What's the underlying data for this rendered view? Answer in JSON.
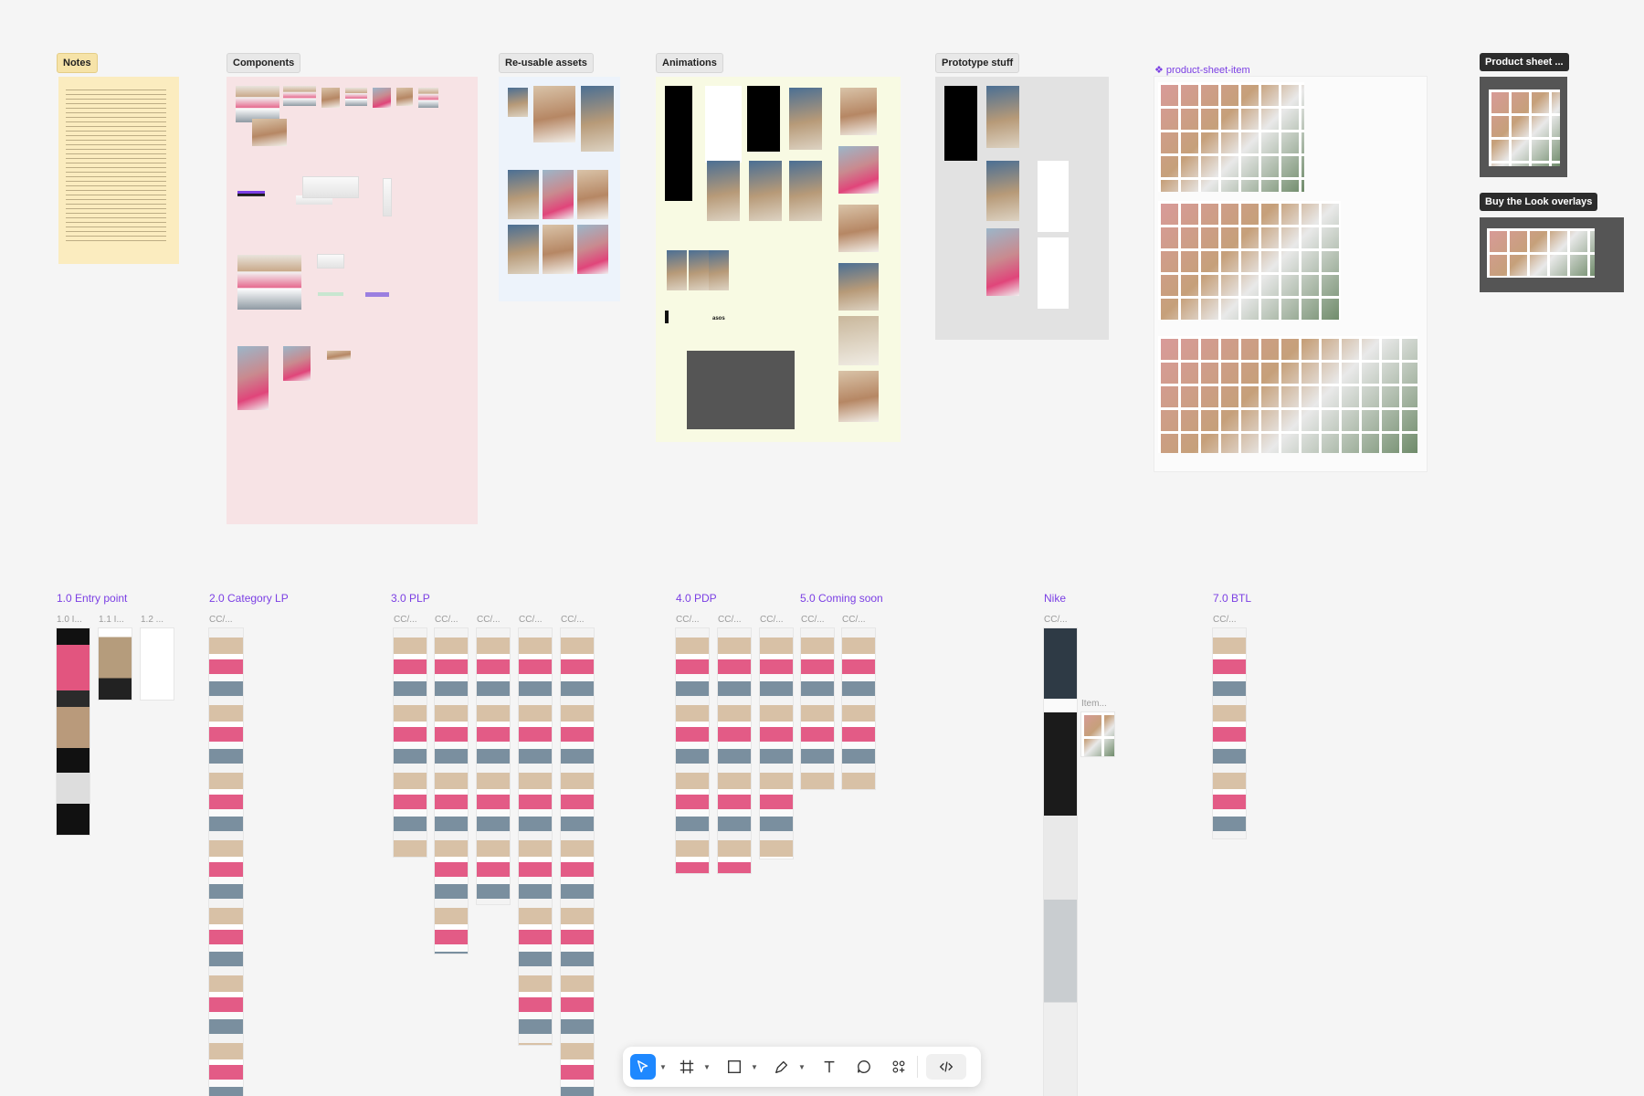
{
  "top_tags": {
    "notes": "Notes",
    "components": "Components",
    "reusable": "Re-usable assets",
    "animations": "Animations",
    "prototype": "Prototype stuff",
    "product_sheet_item": "product-sheet-item",
    "product_sheet": "Product sheet ...",
    "buy_the_look": "Buy the Look overlays"
  },
  "sections": [
    {
      "title": "1.0 Entry point",
      "labels": [
        "1.0 I...",
        "1.1 I...",
        "1.2 ..."
      ]
    },
    {
      "title": "2.0 Category LP",
      "labels": [
        "CC/..."
      ]
    },
    {
      "title": "3.0 PLP",
      "labels": [
        "CC/...",
        "CC/...",
        "CC/...",
        "CC/...",
        "CC/..."
      ]
    },
    {
      "title": "4.0 PDP",
      "labels": [
        "CC/...",
        "CC/...",
        "CC/..."
      ]
    },
    {
      "title": "5.0 Coming soon",
      "labels": [
        "CC/...",
        "CC/..."
      ]
    },
    {
      "title": "Nike",
      "labels": [
        "CC/..."
      ]
    },
    {
      "title": "7.0 BTL",
      "labels": [
        "CC/..."
      ]
    }
  ],
  "nike_item_label": "Item...",
  "brand_text": "asos",
  "toolbar": {
    "tools": [
      "move-tool",
      "frame-tool",
      "shape-tool",
      "pen-tool",
      "text-tool",
      "comment-tool",
      "actions-tool",
      "dev-mode-toggle"
    ]
  },
  "colors": {
    "accent": "#7b3fe4",
    "active_tool": "#1e88ff",
    "canvas": "#f5f5f5"
  }
}
